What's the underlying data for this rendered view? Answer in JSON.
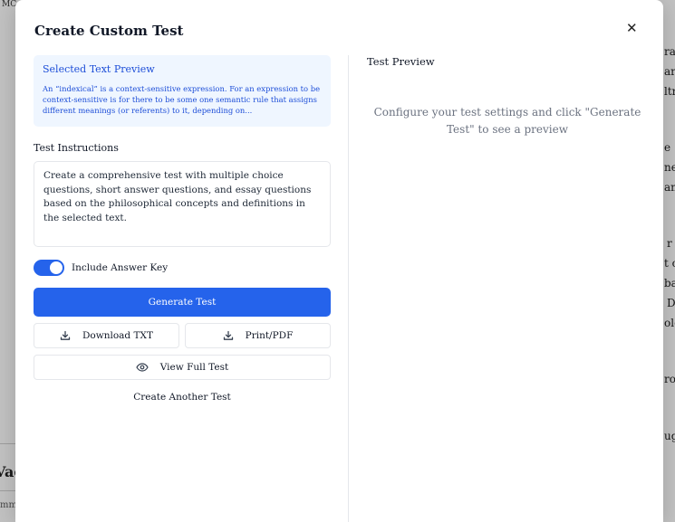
{
  "background": {
    "tab_label": "MC",
    "heading_fragment": "Vac",
    "small_fragment": "mm",
    "right_fragments": [
      "ra",
      "ar",
      "ltr",
      "e",
      "ne",
      "an",
      "r",
      "t c",
      "ba",
      "D",
      "ole",
      "ro",
      "ug"
    ]
  },
  "modal": {
    "title": "Create Custom Test",
    "close_glyph": "✕",
    "page_close_glyph": "✕"
  },
  "preview": {
    "title": "Selected Text Preview",
    "text": "An “indexical” is a context-sensitive expression. For an expression to be context-sensitive is for there to be some one semantic rule that assigns different meanings (or referents) to it, depending on..."
  },
  "instructions": {
    "label": "Test Instructions",
    "value": "Create a comprehensive test with multiple choice questions, short answer questions, and essay questions based on the philosophical concepts and definitions in the selected text."
  },
  "answer_key": {
    "label": "Include Answer Key",
    "checked": true
  },
  "buttons": {
    "generate": "Generate Test",
    "download": "Download TXT",
    "print": "Print/PDF",
    "view_full": "View Full Test",
    "create_another": "Create Another Test"
  },
  "right_panel": {
    "title": "Test Preview",
    "empty_message": "Configure your test settings and click \"Generate Test\" to see a preview"
  },
  "colors": {
    "accent": "#2563eb",
    "preview_bg": "#eff6ff",
    "preview_text": "#1d4ed8",
    "muted_text": "#6b7280"
  },
  "icons": {
    "download": "download-icon",
    "print": "download-icon",
    "view": "eye-icon",
    "close": "close-icon"
  }
}
